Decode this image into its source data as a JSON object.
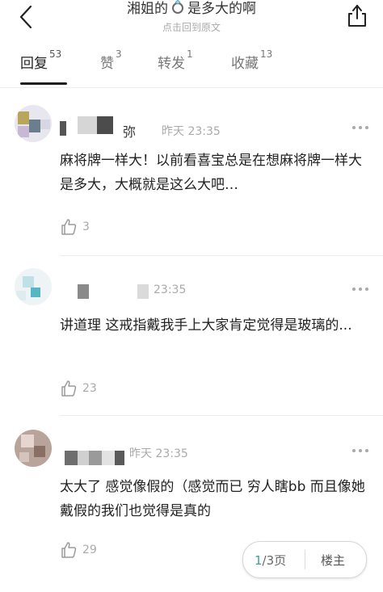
{
  "header": {
    "title_before": "湘姐的",
    "title_after": "是多大的啊",
    "subtitle": "点击回到原文"
  },
  "tabs": [
    {
      "label": "回复",
      "count": "53"
    },
    {
      "label": "赞",
      "count": "3"
    },
    {
      "label": "转发",
      "count": "1"
    },
    {
      "label": "收藏",
      "count": "13"
    }
  ],
  "comments": [
    {
      "nick_tail": "弥",
      "time": "昨天 23:35",
      "text": "麻将牌一样大！以前看喜宝总是在想麻将牌一样大是多大，大概就是这么大吧…",
      "likes": "3"
    },
    {
      "nick_tail": "",
      "time": "23:35",
      "text": "讲道理 这戒指戴我手上大家肯定觉得是玻璃的...",
      "likes": "23"
    },
    {
      "nick_tail": "",
      "time": "昨天 23:35",
      "text": "太大了 感觉像假的（感觉而已 穷人瞎bb 而且像她戴假的我们也觉得是真的",
      "likes": "29"
    }
  ],
  "pager": {
    "current": "1",
    "total_label": "/3页",
    "owner_label": "楼主"
  },
  "colors": {
    "accent": "#3aa0a6",
    "text": "#222222",
    "muted": "#aaaaaa"
  },
  "icons": [
    "back-arrow-icon",
    "ring-emoji-icon",
    "share-icon",
    "more-dots-icon",
    "thumb-up-icon"
  ]
}
